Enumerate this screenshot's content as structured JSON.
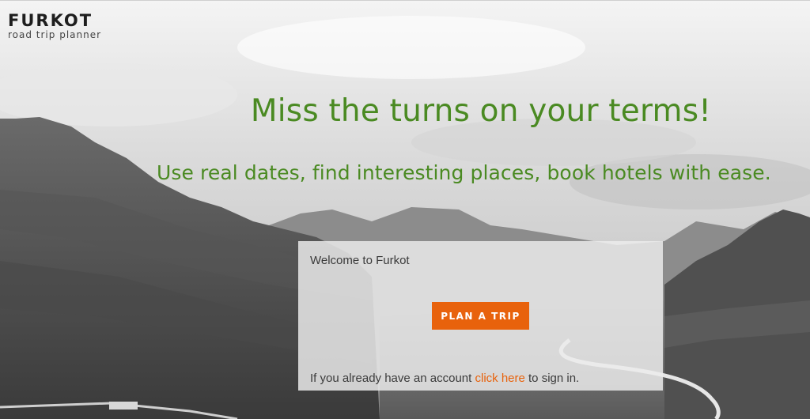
{
  "brand": {
    "name": "FURKOT",
    "tagline": "road trip planner"
  },
  "hero": {
    "headline": "Miss the turns on your terms!",
    "subheadline": "Use real dates, find interesting places, book hotels with ease."
  },
  "card": {
    "welcome": "Welcome to Furkot",
    "plan_button": "PLAN A TRIP",
    "signin_prefix": "If you already have an account",
    "signin_link": "click here",
    "signin_suffix": "to sign in."
  },
  "colors": {
    "headline": "#4a8a22",
    "button": "#e8620c",
    "link": "#e8620c"
  }
}
